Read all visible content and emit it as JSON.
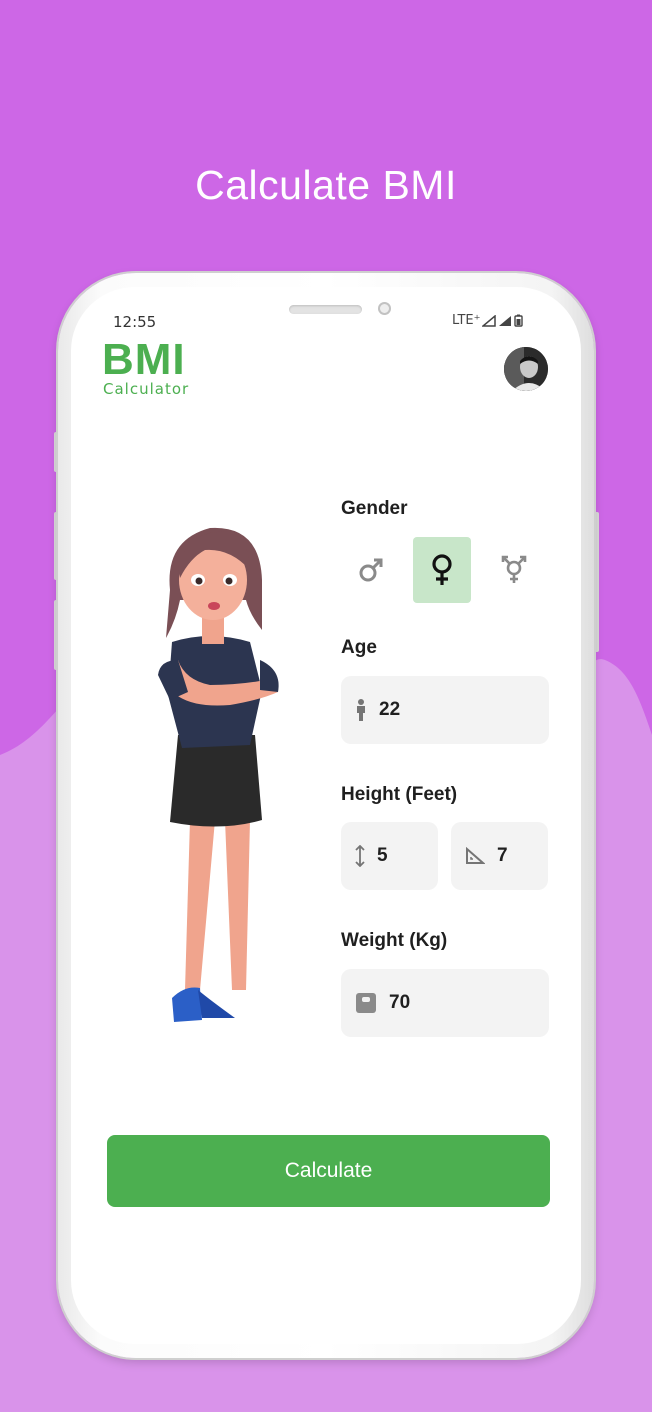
{
  "headline": "Calculate BMI",
  "status_bar": {
    "time": "12:55",
    "network": "LTE⁺"
  },
  "app_header": {
    "logo_main": "BMI",
    "logo_sub": "Calculator"
  },
  "gender": {
    "label": "Gender",
    "options": [
      {
        "glyph": "♂",
        "selected": false
      },
      {
        "glyph": "♀",
        "selected": true
      },
      {
        "glyph": "⚧",
        "selected": false
      }
    ]
  },
  "age": {
    "label": "Age",
    "value": "22"
  },
  "height": {
    "label": "Height (Feet)",
    "feet": "5",
    "inches": "7"
  },
  "weight": {
    "label": "Weight (Kg)",
    "value": "70"
  },
  "calculate_button": {
    "label": "Calculate"
  },
  "colors": {
    "background_top": "#cd67e6",
    "background_bottom": "#d993ea",
    "accent": "#4caf50",
    "selected_gender_bg": "#c8e6c9",
    "field_bg": "#f3f3f3"
  },
  "icons": [
    "male-icon",
    "female-icon",
    "transgender-icon",
    "person-icon",
    "height-icon",
    "ruler-icon",
    "scale-icon"
  ]
}
